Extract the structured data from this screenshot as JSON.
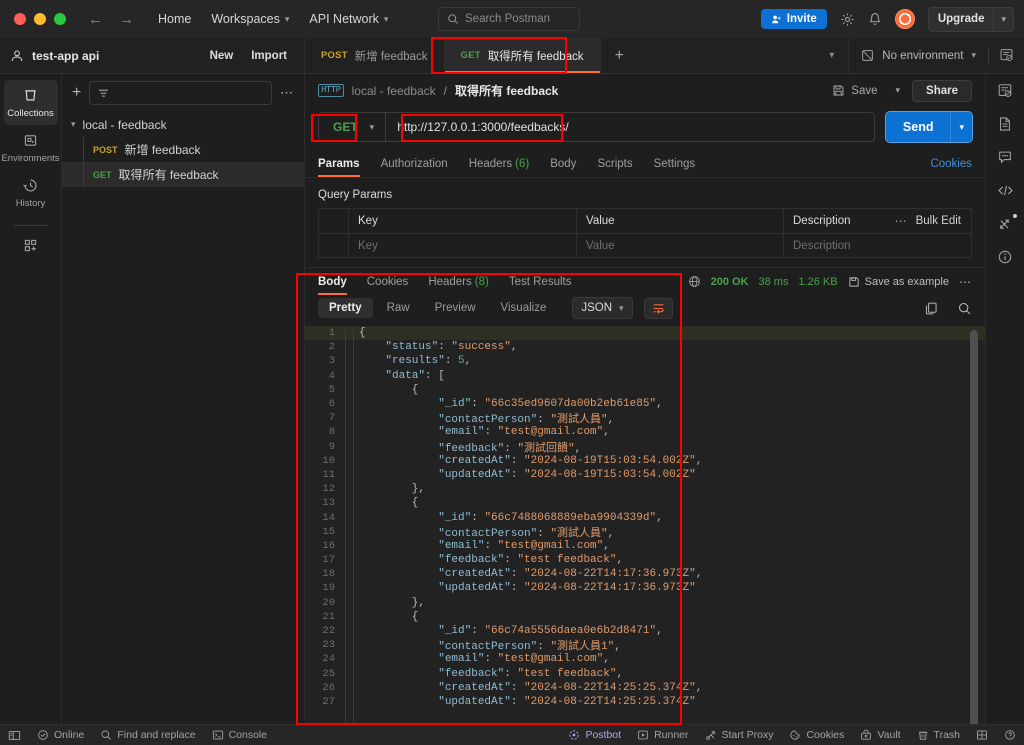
{
  "titlebar": {
    "nav": {
      "back": "←",
      "forward": "→"
    },
    "menu": [
      {
        "label": "Home",
        "caret": false
      },
      {
        "label": "Workspaces",
        "caret": true
      },
      {
        "label": "API Network",
        "caret": true
      }
    ],
    "search_placeholder": "Search Postman",
    "invite_label": "Invite",
    "upgrade_label": "Upgrade"
  },
  "workspace": {
    "name": "test-app api",
    "new_label": "New",
    "import_label": "Import",
    "tabs": [
      {
        "method": "POST",
        "label": "新增 feedback",
        "active": false
      },
      {
        "method": "GET",
        "label": "取得所有 feedback",
        "active": true
      }
    ],
    "add_tab": "+",
    "environment": "No environment"
  },
  "rail": {
    "items": [
      {
        "label": "Collections",
        "icon": "collections-icon",
        "active": true
      },
      {
        "label": "Environments",
        "icon": "environments-icon",
        "active": false
      },
      {
        "label": "History",
        "icon": "history-icon",
        "active": false
      }
    ],
    "add_label": "add-module-icon"
  },
  "collections": {
    "filter_placeholder": "",
    "tree": {
      "root": "local - feedback",
      "requests": [
        {
          "method": "POST",
          "name": "新增 feedback",
          "selected": false
        },
        {
          "method": "GET",
          "name": "取得所有 feedback",
          "selected": true
        }
      ]
    }
  },
  "request": {
    "breadcrumb": {
      "protocol": "HTTP",
      "collection": "local - feedback",
      "separator": "/",
      "name": "取得所有 feedback"
    },
    "save_label": "Save",
    "share_label": "Share",
    "method": "GET",
    "url": "http://127.0.0.1:3000/feedbacks/",
    "send_label": "Send",
    "tabs": [
      {
        "label": "Params",
        "count": "",
        "active": true
      },
      {
        "label": "Authorization",
        "count": "",
        "active": false
      },
      {
        "label": "Headers",
        "count": "(6)",
        "active": false
      },
      {
        "label": "Body",
        "count": "",
        "active": false
      },
      {
        "label": "Scripts",
        "count": "",
        "active": false
      },
      {
        "label": "Settings",
        "count": "",
        "active": false
      }
    ],
    "cookies_link": "Cookies",
    "query_params": {
      "title": "Query Params",
      "headers": [
        "Key",
        "Value",
        "Description"
      ],
      "bulk_edit": "Bulk Edit",
      "rows": [
        {
          "key": "Key",
          "value": "Value",
          "description": "Description"
        }
      ]
    }
  },
  "response": {
    "tabs": [
      {
        "label": "Body",
        "count": "",
        "active": true
      },
      {
        "label": "Cookies",
        "count": "",
        "active": false
      },
      {
        "label": "Headers",
        "count": "(8)",
        "active": false
      },
      {
        "label": "Test Results",
        "count": "",
        "active": false
      }
    ],
    "status": "200 OK",
    "time": "38 ms",
    "size": "1.26 KB",
    "save_as_example": "Save as example",
    "view_modes": [
      {
        "label": "Pretty",
        "active": true
      },
      {
        "label": "Raw",
        "active": false
      },
      {
        "label": "Preview",
        "active": false
      },
      {
        "label": "Visualize",
        "active": false
      }
    ],
    "format": "JSON",
    "body_lines": [
      {
        "n": 1,
        "tokens": [
          {
            "t": "p",
            "v": "{"
          }
        ]
      },
      {
        "n": 2,
        "tokens": [
          {
            "t": "p",
            "v": "    "
          },
          {
            "t": "k",
            "v": "\"status\""
          },
          {
            "t": "p",
            "v": ": "
          },
          {
            "t": "s",
            "v": "\"success\""
          },
          {
            "t": "p",
            "v": ","
          }
        ]
      },
      {
        "n": 3,
        "tokens": [
          {
            "t": "p",
            "v": "    "
          },
          {
            "t": "k",
            "v": "\"results\""
          },
          {
            "t": "p",
            "v": ": "
          },
          {
            "t": "n",
            "v": "5"
          },
          {
            "t": "p",
            "v": ","
          }
        ]
      },
      {
        "n": 4,
        "tokens": [
          {
            "t": "p",
            "v": "    "
          },
          {
            "t": "k",
            "v": "\"data\""
          },
          {
            "t": "p",
            "v": ": ["
          }
        ]
      },
      {
        "n": 5,
        "tokens": [
          {
            "t": "p",
            "v": "        {"
          }
        ]
      },
      {
        "n": 6,
        "tokens": [
          {
            "t": "p",
            "v": "            "
          },
          {
            "t": "k",
            "v": "\"_id\""
          },
          {
            "t": "p",
            "v": ": "
          },
          {
            "t": "s",
            "v": "\"66c35ed9607da00b2eb61e85\""
          },
          {
            "t": "p",
            "v": ","
          }
        ]
      },
      {
        "n": 7,
        "tokens": [
          {
            "t": "p",
            "v": "            "
          },
          {
            "t": "k",
            "v": "\"contactPerson\""
          },
          {
            "t": "p",
            "v": ": "
          },
          {
            "t": "s",
            "v": "\"測試人員\""
          },
          {
            "t": "p",
            "v": ","
          }
        ]
      },
      {
        "n": 8,
        "tokens": [
          {
            "t": "p",
            "v": "            "
          },
          {
            "t": "k",
            "v": "\"email\""
          },
          {
            "t": "p",
            "v": ": "
          },
          {
            "t": "s",
            "v": "\"test@gmail.com\""
          },
          {
            "t": "p",
            "v": ","
          }
        ]
      },
      {
        "n": 9,
        "tokens": [
          {
            "t": "p",
            "v": "            "
          },
          {
            "t": "k",
            "v": "\"feedback\""
          },
          {
            "t": "p",
            "v": ": "
          },
          {
            "t": "s",
            "v": "\"測試回饋\""
          },
          {
            "t": "p",
            "v": ","
          }
        ]
      },
      {
        "n": 10,
        "tokens": [
          {
            "t": "p",
            "v": "            "
          },
          {
            "t": "k",
            "v": "\"createdAt\""
          },
          {
            "t": "p",
            "v": ": "
          },
          {
            "t": "s",
            "v": "\"2024-08-19T15:03:54.002Z\""
          },
          {
            "t": "p",
            "v": ","
          }
        ]
      },
      {
        "n": 11,
        "tokens": [
          {
            "t": "p",
            "v": "            "
          },
          {
            "t": "k",
            "v": "\"updatedAt\""
          },
          {
            "t": "p",
            "v": ": "
          },
          {
            "t": "s",
            "v": "\"2024-08-19T15:03:54.002Z\""
          }
        ]
      },
      {
        "n": 12,
        "tokens": [
          {
            "t": "p",
            "v": "        },"
          }
        ]
      },
      {
        "n": 13,
        "tokens": [
          {
            "t": "p",
            "v": "        {"
          }
        ]
      },
      {
        "n": 14,
        "tokens": [
          {
            "t": "p",
            "v": "            "
          },
          {
            "t": "k",
            "v": "\"_id\""
          },
          {
            "t": "p",
            "v": ": "
          },
          {
            "t": "s",
            "v": "\"66c7488068889eba9904339d\""
          },
          {
            "t": "p",
            "v": ","
          }
        ]
      },
      {
        "n": 15,
        "tokens": [
          {
            "t": "p",
            "v": "            "
          },
          {
            "t": "k",
            "v": "\"contactPerson\""
          },
          {
            "t": "p",
            "v": ": "
          },
          {
            "t": "s",
            "v": "\"測試人員\""
          },
          {
            "t": "p",
            "v": ","
          }
        ]
      },
      {
        "n": 16,
        "tokens": [
          {
            "t": "p",
            "v": "            "
          },
          {
            "t": "k",
            "v": "\"email\""
          },
          {
            "t": "p",
            "v": ": "
          },
          {
            "t": "s",
            "v": "\"test@gmail.com\""
          },
          {
            "t": "p",
            "v": ","
          }
        ]
      },
      {
        "n": 17,
        "tokens": [
          {
            "t": "p",
            "v": "            "
          },
          {
            "t": "k",
            "v": "\"feedback\""
          },
          {
            "t": "p",
            "v": ": "
          },
          {
            "t": "s",
            "v": "\"test feedback\""
          },
          {
            "t": "p",
            "v": ","
          }
        ]
      },
      {
        "n": 18,
        "tokens": [
          {
            "t": "p",
            "v": "            "
          },
          {
            "t": "k",
            "v": "\"createdAt\""
          },
          {
            "t": "p",
            "v": ": "
          },
          {
            "t": "s",
            "v": "\"2024-08-22T14:17:36.973Z\""
          },
          {
            "t": "p",
            "v": ","
          }
        ]
      },
      {
        "n": 19,
        "tokens": [
          {
            "t": "p",
            "v": "            "
          },
          {
            "t": "k",
            "v": "\"updatedAt\""
          },
          {
            "t": "p",
            "v": ": "
          },
          {
            "t": "s",
            "v": "\"2024-08-22T14:17:36.973Z\""
          }
        ]
      },
      {
        "n": 20,
        "tokens": [
          {
            "t": "p",
            "v": "        },"
          }
        ]
      },
      {
        "n": 21,
        "tokens": [
          {
            "t": "p",
            "v": "        {"
          }
        ]
      },
      {
        "n": 22,
        "tokens": [
          {
            "t": "p",
            "v": "            "
          },
          {
            "t": "k",
            "v": "\"_id\""
          },
          {
            "t": "p",
            "v": ": "
          },
          {
            "t": "s",
            "v": "\"66c74a5556daea0e6b2d8471\""
          },
          {
            "t": "p",
            "v": ","
          }
        ]
      },
      {
        "n": 23,
        "tokens": [
          {
            "t": "p",
            "v": "            "
          },
          {
            "t": "k",
            "v": "\"contactPerson\""
          },
          {
            "t": "p",
            "v": ": "
          },
          {
            "t": "s",
            "v": "\"測試人員1\""
          },
          {
            "t": "p",
            "v": ","
          }
        ]
      },
      {
        "n": 24,
        "tokens": [
          {
            "t": "p",
            "v": "            "
          },
          {
            "t": "k",
            "v": "\"email\""
          },
          {
            "t": "p",
            "v": ": "
          },
          {
            "t": "s",
            "v": "\"test@gmail.com\""
          },
          {
            "t": "p",
            "v": ","
          }
        ]
      },
      {
        "n": 25,
        "tokens": [
          {
            "t": "p",
            "v": "            "
          },
          {
            "t": "k",
            "v": "\"feedback\""
          },
          {
            "t": "p",
            "v": ": "
          },
          {
            "t": "s",
            "v": "\"test feedback\""
          },
          {
            "t": "p",
            "v": ","
          }
        ]
      },
      {
        "n": 26,
        "tokens": [
          {
            "t": "p",
            "v": "            "
          },
          {
            "t": "k",
            "v": "\"createdAt\""
          },
          {
            "t": "p",
            "v": ": "
          },
          {
            "t": "s",
            "v": "\"2024-08-22T14:25:25.374Z\""
          },
          {
            "t": "p",
            "v": ","
          }
        ]
      },
      {
        "n": 27,
        "tokens": [
          {
            "t": "p",
            "v": "            "
          },
          {
            "t": "k",
            "v": "\"updatedAt\""
          },
          {
            "t": "p",
            "v": ": "
          },
          {
            "t": "s",
            "v": "\"2024-08-22T14:25:25.374Z\""
          }
        ]
      }
    ]
  },
  "statusbar": {
    "left": [
      {
        "label": "Online",
        "icon": "online-icon"
      },
      {
        "label": "Find and replace",
        "icon": "search-icon"
      },
      {
        "label": "Console",
        "icon": "console-icon"
      }
    ],
    "right": [
      {
        "label": "Postbot",
        "icon": "postbot-icon"
      },
      {
        "label": "Runner",
        "icon": "runner-icon"
      },
      {
        "label": "Start Proxy",
        "icon": "proxy-icon"
      },
      {
        "label": "Cookies",
        "icon": "cookies-icon"
      },
      {
        "label": "Vault",
        "icon": "vault-icon"
      },
      {
        "label": "Trash",
        "icon": "trash-icon"
      }
    ]
  },
  "colors": {
    "accent": "#ff6c37",
    "primary": "#0b72d4",
    "get_green": "#4aa24a",
    "post_yellow": "#c9a227",
    "annotation": "#ff0000"
  }
}
